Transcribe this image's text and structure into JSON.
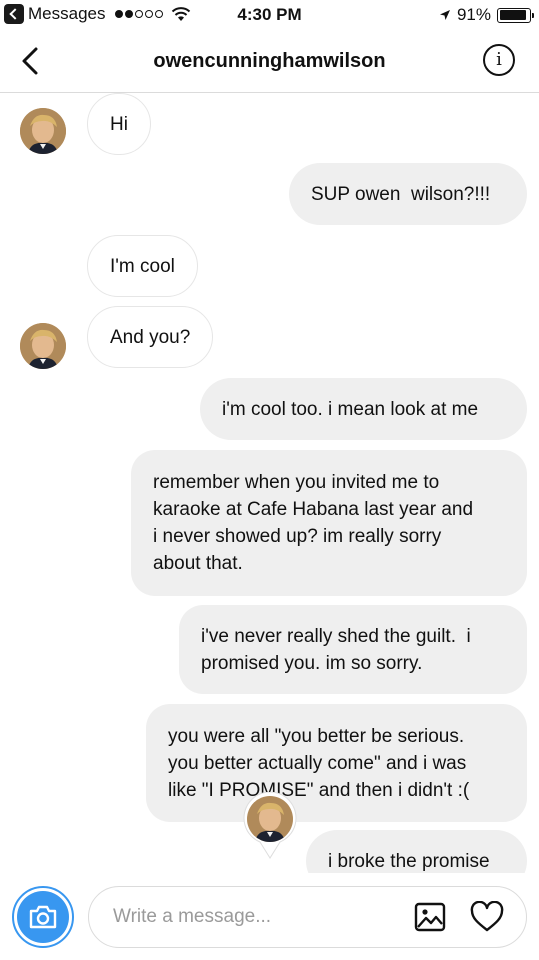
{
  "status_bar": {
    "back_app": "Messages",
    "time": "4:30 PM",
    "battery": "91%",
    "battery_level": 0.91
  },
  "header": {
    "username": "owencunninghamwilson"
  },
  "messages": [
    {
      "from": "them",
      "text": "Hi"
    },
    {
      "from": "me",
      "text": "SUP owen  wilson?!!!"
    },
    {
      "from": "them",
      "text": "I'm cool"
    },
    {
      "from": "them",
      "text": "And you?"
    },
    {
      "from": "me",
      "text": "i'm cool too. i mean look at me"
    },
    {
      "from": "me",
      "lines": [
        "remember when you invited me to",
        "karaoke at Cafe Habana last year and",
        "i never showed up? im really sorry",
        "about that."
      ]
    },
    {
      "from": "me",
      "lines": [
        "i've never really shed the guilt.  i",
        "promised you. im so sorry."
      ]
    },
    {
      "from": "me",
      "lines": [
        "you were all \"you better be serious.",
        "you better actually come\" and i was",
        "like \"I PROMISE\" and then i didn't :("
      ]
    },
    {
      "from": "me",
      "text": "i broke the promise"
    }
  ],
  "composer": {
    "placeholder": "Write a message..."
  },
  "colors": {
    "accent": "#3897f0",
    "out_bubble": "#efefef",
    "in_bubble_border": "#e6e6e6"
  }
}
